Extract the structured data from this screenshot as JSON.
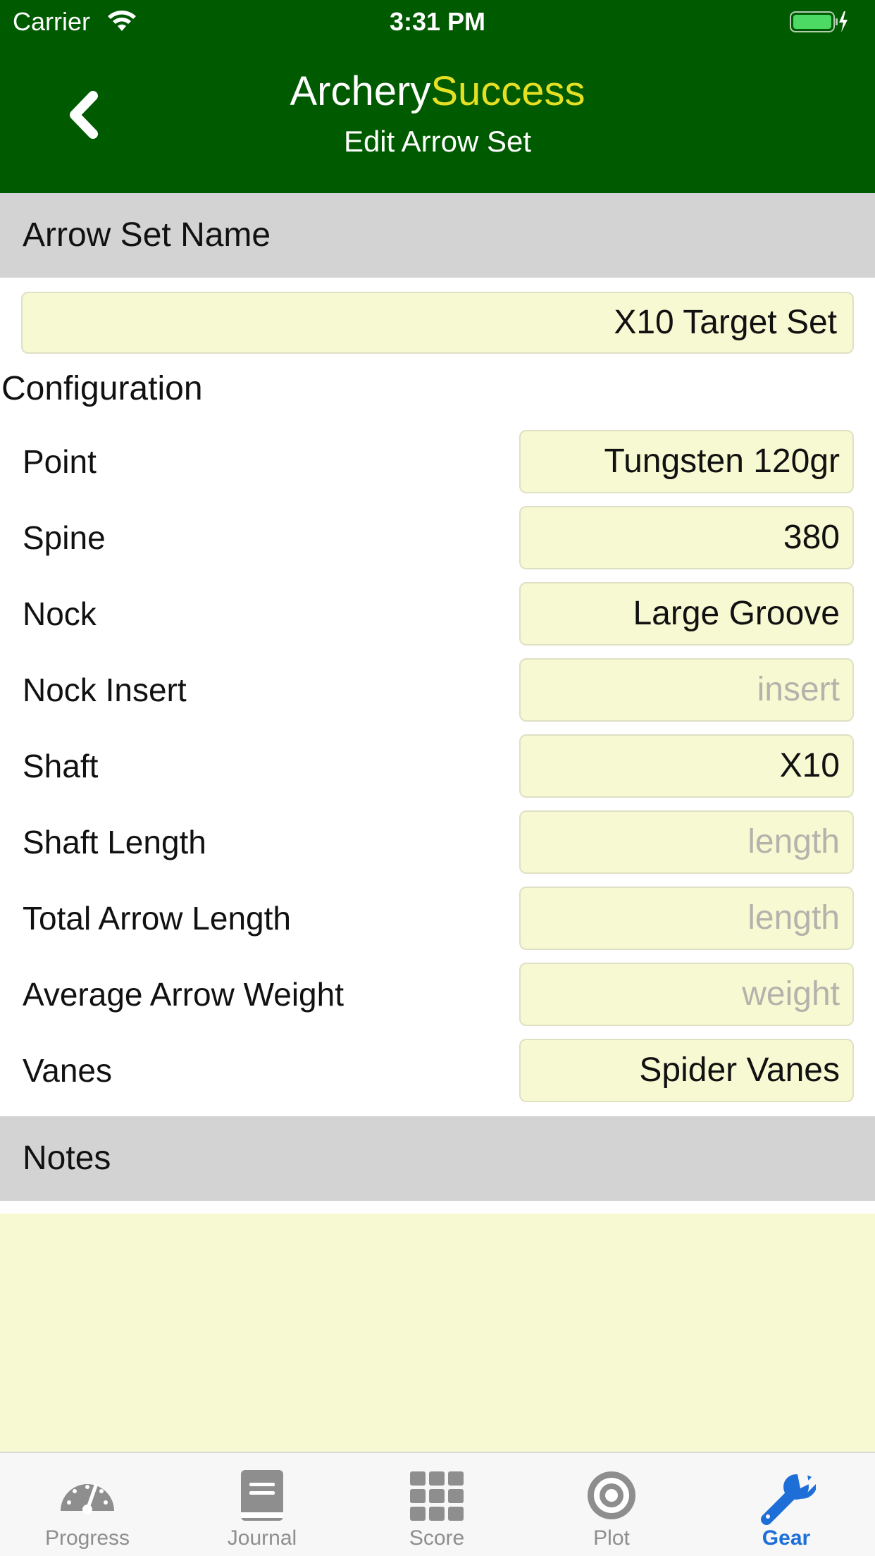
{
  "status_bar": {
    "carrier": "Carrier",
    "time": "3:31 PM"
  },
  "header": {
    "title_part1": "Archery",
    "title_part2": "Success",
    "subtitle": "Edit Arrow Set",
    "accent_color": "#e5e024",
    "background_color": "#005a00"
  },
  "name_section": {
    "title": "Arrow Set Name",
    "value": "X10 Target Set"
  },
  "configuration": {
    "title": "Configuration",
    "rows": [
      {
        "label": "Point",
        "value": "Tungsten 120gr",
        "placeholder": ""
      },
      {
        "label": "Spine",
        "value": "380",
        "placeholder": ""
      },
      {
        "label": "Nock",
        "value": "Large Groove",
        "placeholder": ""
      },
      {
        "label": "Nock Insert",
        "value": "",
        "placeholder": "insert"
      },
      {
        "label": "Shaft",
        "value": "X10",
        "placeholder": ""
      },
      {
        "label": "Shaft Length",
        "value": "",
        "placeholder": "length"
      },
      {
        "label": "Total Arrow Length",
        "value": "",
        "placeholder": "length"
      },
      {
        "label": "Average Arrow Weight",
        "value": "",
        "placeholder": "weight"
      },
      {
        "label": "Vanes",
        "value": "Spider Vanes",
        "placeholder": ""
      }
    ]
  },
  "notes_section": {
    "title": "Notes",
    "value": ""
  },
  "tabbar": {
    "tabs": [
      {
        "label": "Progress",
        "icon": "gauge-icon",
        "active": false
      },
      {
        "label": "Journal",
        "icon": "book-icon",
        "active": false
      },
      {
        "label": "Score",
        "icon": "grid-icon",
        "active": false
      },
      {
        "label": "Plot",
        "icon": "target-icon",
        "active": false
      },
      {
        "label": "Gear",
        "icon": "wrench-icon",
        "active": true
      }
    ],
    "active_color": "#1e6ed8",
    "inactive_color": "#8e8e8e"
  }
}
